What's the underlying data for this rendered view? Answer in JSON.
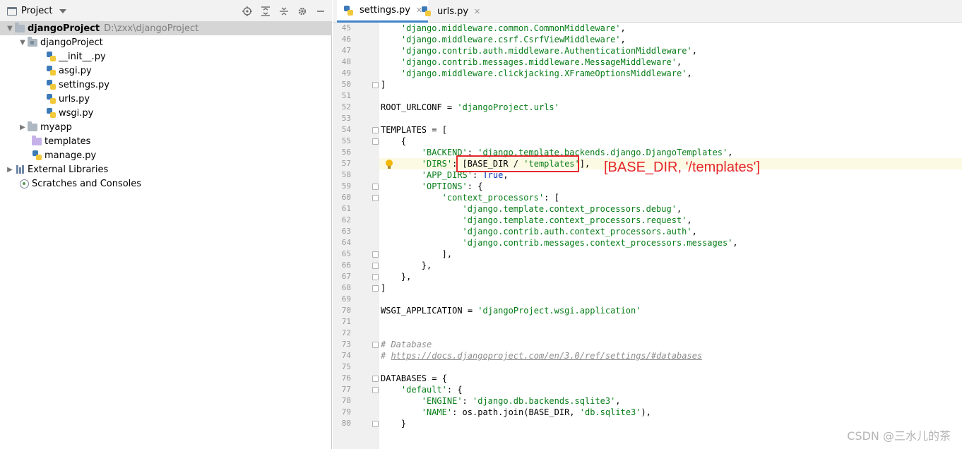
{
  "project_panel": {
    "title": "Project",
    "tools": [
      "locate-icon",
      "expand-all-icon",
      "collapse-all-icon",
      "gear-icon",
      "minimize-icon"
    ],
    "tree": [
      {
        "label": "djangoProject",
        "hint": "D:\\zxx\\djangoProject",
        "depth": 0,
        "kind": "folder",
        "expanded": true,
        "bold": true,
        "selected": true
      },
      {
        "label": "djangoProject",
        "depth": 1,
        "kind": "folder",
        "expanded": true
      },
      {
        "label": "__init__.py",
        "depth": 2,
        "kind": "python"
      },
      {
        "label": "asgi.py",
        "depth": 2,
        "kind": "python"
      },
      {
        "label": "settings.py",
        "depth": 2,
        "kind": "python"
      },
      {
        "label": "urls.py",
        "depth": 2,
        "kind": "python"
      },
      {
        "label": "wsgi.py",
        "depth": 2,
        "kind": "python"
      },
      {
        "label": "myapp",
        "depth": 1,
        "kind": "folder",
        "expanded": false
      },
      {
        "label": "templates",
        "depth": 1,
        "kind": "folder-templates"
      },
      {
        "label": "manage.py",
        "depth": 1,
        "kind": "python"
      },
      {
        "label": "External Libraries",
        "depth": 0,
        "kind": "libraries",
        "expanded": false
      },
      {
        "label": "Scratches and Consoles",
        "depth": 0,
        "kind": "scratches"
      }
    ]
  },
  "editor": {
    "tabs": [
      {
        "label": "settings.py",
        "active": true
      },
      {
        "label": "urls.py",
        "active": false
      }
    ],
    "highlighted_line": 57,
    "lines": [
      {
        "n": "45",
        "indent": 8,
        "parts": [
          {
            "t": "'django.middleware.common.CommonMiddleware'",
            "c": "str"
          },
          {
            "t": ",",
            "c": ""
          }
        ]
      },
      {
        "n": "46",
        "indent": 8,
        "parts": [
          {
            "t": "'django.middleware.csrf.CsrfViewMiddleware'",
            "c": "str"
          },
          {
            "t": ",",
            "c": ""
          }
        ]
      },
      {
        "n": "47",
        "indent": 8,
        "parts": [
          {
            "t": "'django.contrib.auth.middleware.AuthenticationMiddleware'",
            "c": "str"
          },
          {
            "t": ",",
            "c": ""
          }
        ]
      },
      {
        "n": "48",
        "indent": 8,
        "parts": [
          {
            "t": "'django.contrib.messages.middleware.MessageMiddleware'",
            "c": "str"
          },
          {
            "t": ",",
            "c": ""
          }
        ]
      },
      {
        "n": "49",
        "indent": 8,
        "parts": [
          {
            "t": "'django.middleware.clickjacking.XFrameOptionsMiddleware'",
            "c": "str"
          },
          {
            "t": ",",
            "c": ""
          }
        ]
      },
      {
        "n": "50",
        "indent": 4,
        "parts": [
          {
            "t": "]",
            "c": ""
          }
        ],
        "fold": true
      },
      {
        "n": "51",
        "indent": 4,
        "parts": []
      },
      {
        "n": "52",
        "indent": 4,
        "parts": [
          {
            "t": "ROOT_URLCONF = ",
            "c": ""
          },
          {
            "t": "'djangoProject.urls'",
            "c": "str"
          }
        ]
      },
      {
        "n": "53",
        "indent": 4,
        "parts": []
      },
      {
        "n": "54",
        "indent": 4,
        "parts": [
          {
            "t": "TEMPLATES = [",
            "c": ""
          }
        ],
        "fold": true
      },
      {
        "n": "55",
        "indent": 8,
        "parts": [
          {
            "t": "{",
            "c": ""
          }
        ],
        "fold": true
      },
      {
        "n": "56",
        "indent": 12,
        "parts": [
          {
            "t": "'BACKEND'",
            "c": "str"
          },
          {
            "t": ": ",
            "c": ""
          },
          {
            "t": "'django.template.backends.django.DjangoTemplates'",
            "c": "str"
          },
          {
            "t": ",",
            "c": ""
          }
        ]
      },
      {
        "n": "57",
        "indent": 12,
        "parts": [
          {
            "t": "'DIRS'",
            "c": "str"
          },
          {
            "t": ": [BASE_DIR / ",
            "c": ""
          },
          {
            "t": "'templates'",
            "c": "str"
          },
          {
            "t": "],",
            "c": ""
          }
        ],
        "bulb": true
      },
      {
        "n": "58",
        "indent": 12,
        "parts": [
          {
            "t": "'APP_DIRS'",
            "c": "str"
          },
          {
            "t": ": ",
            "c": ""
          },
          {
            "t": "True",
            "c": "kw"
          },
          {
            "t": ",",
            "c": ""
          }
        ]
      },
      {
        "n": "59",
        "indent": 12,
        "parts": [
          {
            "t": "'OPTIONS'",
            "c": "str"
          },
          {
            "t": ": {",
            "c": ""
          }
        ],
        "fold": true
      },
      {
        "n": "60",
        "indent": 16,
        "parts": [
          {
            "t": "'context_processors'",
            "c": "str"
          },
          {
            "t": ": [",
            "c": ""
          }
        ],
        "fold": true
      },
      {
        "n": "61",
        "indent": 20,
        "parts": [
          {
            "t": "'django.template.context_processors.debug'",
            "c": "str"
          },
          {
            "t": ",",
            "c": ""
          }
        ]
      },
      {
        "n": "62",
        "indent": 20,
        "parts": [
          {
            "t": "'django.template.context_processors.request'",
            "c": "str"
          },
          {
            "t": ",",
            "c": ""
          }
        ]
      },
      {
        "n": "63",
        "indent": 20,
        "parts": [
          {
            "t": "'django.contrib.auth.context_processors.auth'",
            "c": "str"
          },
          {
            "t": ",",
            "c": ""
          }
        ]
      },
      {
        "n": "64",
        "indent": 20,
        "parts": [
          {
            "t": "'django.contrib.messages.context_processors.messages'",
            "c": "str"
          },
          {
            "t": ",",
            "c": ""
          }
        ]
      },
      {
        "n": "65",
        "indent": 16,
        "parts": [
          {
            "t": "],",
            "c": ""
          }
        ],
        "fold": true
      },
      {
        "n": "66",
        "indent": 12,
        "parts": [
          {
            "t": "},",
            "c": ""
          }
        ],
        "fold": true
      },
      {
        "n": "67",
        "indent": 8,
        "parts": [
          {
            "t": "},",
            "c": ""
          }
        ],
        "fold": true
      },
      {
        "n": "68",
        "indent": 4,
        "parts": [
          {
            "t": "]",
            "c": ""
          }
        ],
        "fold": true
      },
      {
        "n": "69",
        "indent": 4,
        "parts": []
      },
      {
        "n": "70",
        "indent": 4,
        "parts": [
          {
            "t": "WSGI_APPLICATION = ",
            "c": ""
          },
          {
            "t": "'djangoProject.wsgi.application'",
            "c": "str"
          }
        ]
      },
      {
        "n": "71",
        "indent": 4,
        "parts": []
      },
      {
        "n": "72",
        "indent": 4,
        "parts": []
      },
      {
        "n": "73",
        "indent": 4,
        "parts": [
          {
            "t": "# Database",
            "c": "cmt"
          }
        ],
        "fold": true
      },
      {
        "n": "74",
        "indent": 4,
        "parts": [
          {
            "t": "# ",
            "c": "cmt"
          },
          {
            "t": "https://docs.djangoproject.com/en/3.0/ref/settings/#databases",
            "c": "url"
          }
        ]
      },
      {
        "n": "75",
        "indent": 4,
        "parts": []
      },
      {
        "n": "76",
        "indent": 4,
        "parts": [
          {
            "t": "DATABASES = {",
            "c": ""
          }
        ],
        "fold": true
      },
      {
        "n": "77",
        "indent": 8,
        "parts": [
          {
            "t": "'default'",
            "c": "str"
          },
          {
            "t": ": {",
            "c": ""
          }
        ],
        "fold": true
      },
      {
        "n": "78",
        "indent": 12,
        "parts": [
          {
            "t": "'ENGINE'",
            "c": "str"
          },
          {
            "t": ": ",
            "c": ""
          },
          {
            "t": "'django.db.backends.sqlite3'",
            "c": "str"
          },
          {
            "t": ",",
            "c": ""
          }
        ]
      },
      {
        "n": "79",
        "indent": 12,
        "parts": [
          {
            "t": "'NAME'",
            "c": "str"
          },
          {
            "t": ": os.path.",
            "c": ""
          },
          {
            "t": "join",
            "c": "fn"
          },
          {
            "t": "(BASE_DIR, ",
            "c": ""
          },
          {
            "t": "'db.sqlite3'",
            "c": "str"
          },
          {
            "t": "),",
            "c": ""
          }
        ]
      },
      {
        "n": "80",
        "indent": 8,
        "parts": [
          {
            "t": "}",
            "c": ""
          }
        ],
        "fold": true
      }
    ]
  },
  "annotation": {
    "text": "[BASE_DIR, '/templates']",
    "color": "#e5272a"
  },
  "watermark": "CSDN @三水儿的茶",
  "colors": {
    "string": "#067d17",
    "comment": "#8c8c8c",
    "keyword": "#0033b3",
    "tab_accent": "#4083c9",
    "highlight_line": "#fcfae3"
  }
}
